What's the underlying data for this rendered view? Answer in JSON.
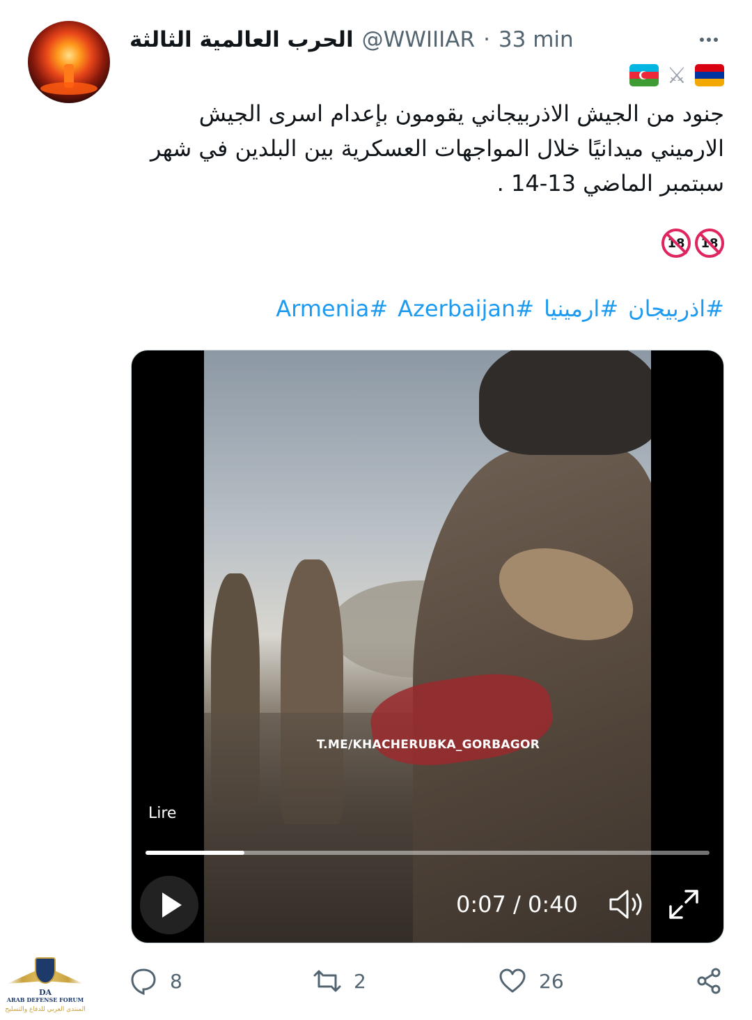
{
  "tweet": {
    "display_name": "الحرب العالمية الثالثة",
    "handle": "@WWIIIAR",
    "separator": "·",
    "time": "33 min",
    "text_lines": [
      "جنود من الجيش الاذربيجاني يقومون بإعدام اسرى الجيش",
      "الارميني ميدانيًا خلال المواجهات العسكرية بين البلدين في شهر",
      "سبتمبر الماضي 13-14 ."
    ],
    "age_badges": [
      "18",
      "18"
    ],
    "hashtags": [
      "#اذربيجان",
      "#ارمينيا",
      "#Azerbaijan",
      "#Armenia"
    ]
  },
  "colors": {
    "link": "#1d9bf0",
    "muted": "#536471",
    "text": "#0f1419",
    "flag_az": [
      "#00b5e2",
      "#ed2939",
      "#3f9c35"
    ],
    "flag_am": [
      "#d90012",
      "#0033a0",
      "#f2a800"
    ]
  },
  "icons": {
    "more": "more-dots-icon",
    "reply": "reply-bubble-icon",
    "retweet": "retweet-icon",
    "like": "heart-icon",
    "share": "share-icon",
    "swords": "crossed-swords-icon",
    "volume": "speaker-icon",
    "fullscreen": "expand-icon",
    "play": "play-icon"
  },
  "video": {
    "watermark": "T.ME/KHACHERUBKA_GORBAGOR",
    "play_label": "Lire",
    "current_time": "0:07",
    "time_separator": " / ",
    "duration": "0:40",
    "progress_fraction": 0.175
  },
  "actions": {
    "replies": "8",
    "retweets": "2",
    "likes": "26"
  },
  "forum_logo": {
    "initials": "DA",
    "name_en": "ARAB DEFENSE FORUM",
    "name_ar": "المنتدى العربي للدفاع والتسليح"
  }
}
